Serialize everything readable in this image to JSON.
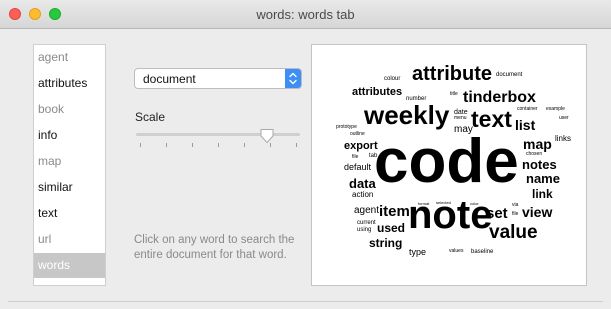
{
  "window": {
    "title": "words: words tab"
  },
  "sidebar": {
    "items": [
      {
        "label": "agent",
        "state": "dim"
      },
      {
        "label": "attributes",
        "state": "normal"
      },
      {
        "label": "book",
        "state": "dim"
      },
      {
        "label": "info",
        "state": "normal"
      },
      {
        "label": "map",
        "state": "dim"
      },
      {
        "label": "similar",
        "state": "normal"
      },
      {
        "label": "text",
        "state": "normal"
      },
      {
        "label": "url",
        "state": "dim"
      },
      {
        "label": "words",
        "state": "selected"
      }
    ]
  },
  "controls": {
    "scope_select": {
      "value": "document"
    },
    "scale_label": "Scale",
    "scale_level": 0.8,
    "hint": "Click on any word to search the entire document for that word."
  },
  "word_cloud": {
    "words": [
      "colour",
      "attribute",
      "document",
      "attributes",
      "number",
      "title",
      "tinderbox",
      "weekly",
      "date",
      "menu",
      "text",
      "container",
      "example",
      "user",
      "prototype",
      "outline",
      "may",
      "list",
      "links",
      "code",
      "export",
      "map",
      "chosen",
      "file",
      "tab",
      "notes",
      "default",
      "name",
      "data",
      "action",
      "link",
      "format",
      "selected",
      "color",
      "via",
      "agent",
      "item",
      "note",
      "set",
      "view",
      "file",
      "current",
      "using",
      "used",
      "value",
      "string",
      "type",
      "values",
      "baseline"
    ]
  },
  "colors": {
    "selected_tab": "#c7c7c7",
    "stepper_accent": "#3e8ef7",
    "close": "#fc5f57",
    "minimize": "#fdbc2e",
    "zoom": "#28c840"
  }
}
